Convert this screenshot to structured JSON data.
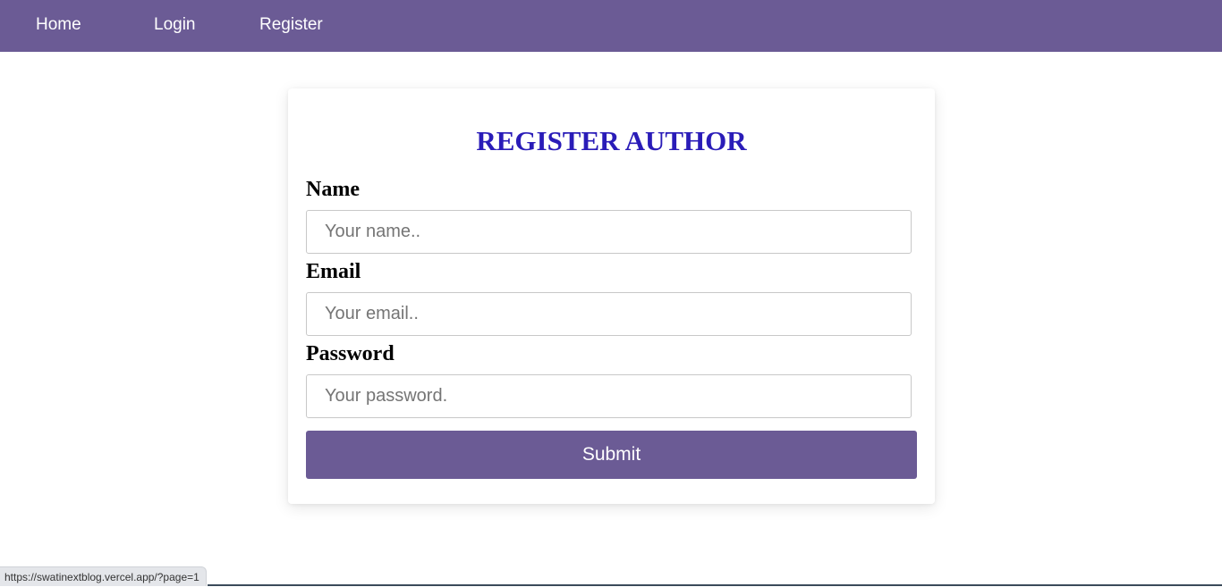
{
  "nav": {
    "home": "Home",
    "login": "Login",
    "register": "Register"
  },
  "form": {
    "title": "REGISTER AUTHOR",
    "name_label": "Name",
    "name_placeholder": "Your name..",
    "email_label": "Email",
    "email_placeholder": "Your email..",
    "password_label": "Password",
    "password_placeholder": "Your password.",
    "submit_label": "Submit"
  },
  "status_bar": {
    "url": "https://swatinextblog.vercel.app/?page=1"
  },
  "colors": {
    "nav_background": "#6b5b95",
    "title": "#2a1cb8",
    "submit_background": "#6b5b95"
  }
}
